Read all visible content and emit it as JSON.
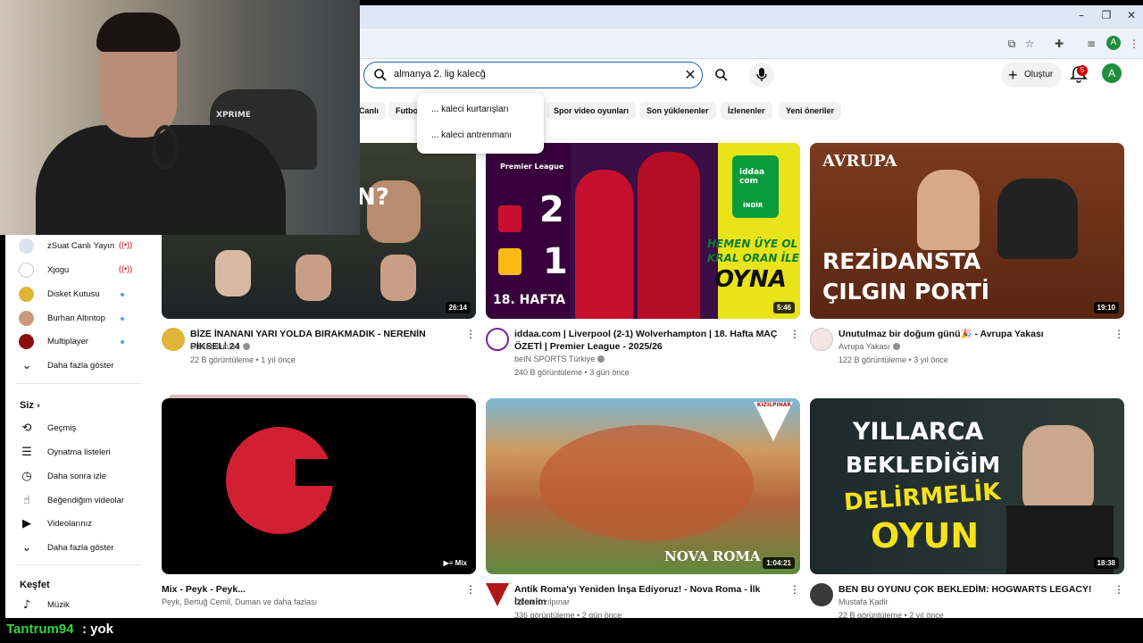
{
  "search": {
    "query": "almanya 2. lig kalecğ",
    "suggestions": [
      "... kaleci kurtarışları",
      "... kaleci antrenmanı"
    ]
  },
  "header": {
    "create_label": "Oluştur",
    "notifications": "5",
    "avatar_letter": "A"
  },
  "chips": [
    "Canlı",
    "Futbol",
    "Spor video oyunları",
    "Son yüklenenler",
    "İzlenenler",
    "Yeni öneriler"
  ],
  "sidebar": {
    "subscriptions": [
      {
        "label": "zSuat Canlı Yayın",
        "status": "live"
      },
      {
        "label": "Xjogu",
        "status": "live"
      },
      {
        "label": "Disket Kutusu",
        "status": "new"
      },
      {
        "label": "Burhan Altıntop",
        "status": "new"
      },
      {
        "label": "Multiplayer",
        "status": "new"
      }
    ],
    "show_more": "Daha fazla göster",
    "you_heading": "Siz",
    "you_items": [
      "Geçmiş",
      "Oynatma listeleri",
      "Daha sonra izle",
      "Beğendiğim videolar",
      "Videolarınız"
    ],
    "show_more_2": "Daha fazla göster",
    "explore_heading": "Keşfet",
    "explore_items": [
      "Müzik"
    ]
  },
  "videos": [
    {
      "title": "BİZE İNANANI YARI YOLDA BIRAKMADIK - NERENİN PİKSELİ 24",
      "channel": "Disket Kutusu",
      "meta": "22 B görüntüleme • 1 yıl önce",
      "duration": "26:14",
      "thumb_text": "N?"
    },
    {
      "title": "iddaa.com | Liverpool (2-1) Wolverhampton | 18. Hafta MAÇ ÖZETİ | Premier League - 2025/26",
      "channel": "beIN SPORTS Türkiye",
      "meta": "240 B görüntüleme • 3 gün önce",
      "duration": "5:46",
      "thumb_text": {
        "league": "Premier League",
        "score_home": "2",
        "score_away": "1",
        "week": "18. HAFTA",
        "promo1": "HEMEN ÜYE OL",
        "promo2": "KRAL ORAN İLE",
        "promo3": "OYNA",
        "brand": "iddaa com",
        "cta": "İNDİR"
      }
    },
    {
      "title": "Unutulmaz bir doğum günü🎉 - Avrupa Yakası",
      "channel": "Avrupa Yakası",
      "meta": "122 B görüntüleme • 3 yıl önce",
      "duration": "19:10",
      "thumb_text": {
        "line1": "REZİDANSTA",
        "line2": "ÇILGIN PORTİ",
        "logo": "AVRUPA"
      }
    },
    {
      "title": "Mix - Peyk - Peyk...",
      "channel": "Peyk, Bertuğ Cemil, Duman ve daha fazlası",
      "meta": "",
      "duration": "Mix"
    },
    {
      "title": "Antik Roma'yı Yeniden İnşa Ediyoruz! - Nova Roma - İlk İzlenim",
      "channel": "Okan Kızılpınar",
      "meta": "336 görüntüleme • 2 gün önce",
      "duration": "1:04:21",
      "thumb_text": {
        "caption": "NOVA ROMA",
        "badge": "KIZILPINAR"
      }
    },
    {
      "title": "BEN BU OYUNU ÇOK BEKLEDİM: HOGWARTS LEGACY!",
      "channel": "Mustafa Kadir",
      "meta": "22 B görüntüleme • 2 yıl önce",
      "duration": "18:38",
      "thumb_text": {
        "line1": "YILLARCA",
        "line2": "BEKLEDİĞİM",
        "line3": "DELİRMELİK",
        "line4": "OYUN"
      }
    }
  ],
  "webcam": {
    "headset_brand": "XPRIME"
  },
  "chat": {
    "user": "Tantrum94",
    "message": ": yok"
  },
  "colors": {
    "accent": "#065fd4",
    "live": "#cc0000",
    "chat_user": "#37d53c"
  }
}
